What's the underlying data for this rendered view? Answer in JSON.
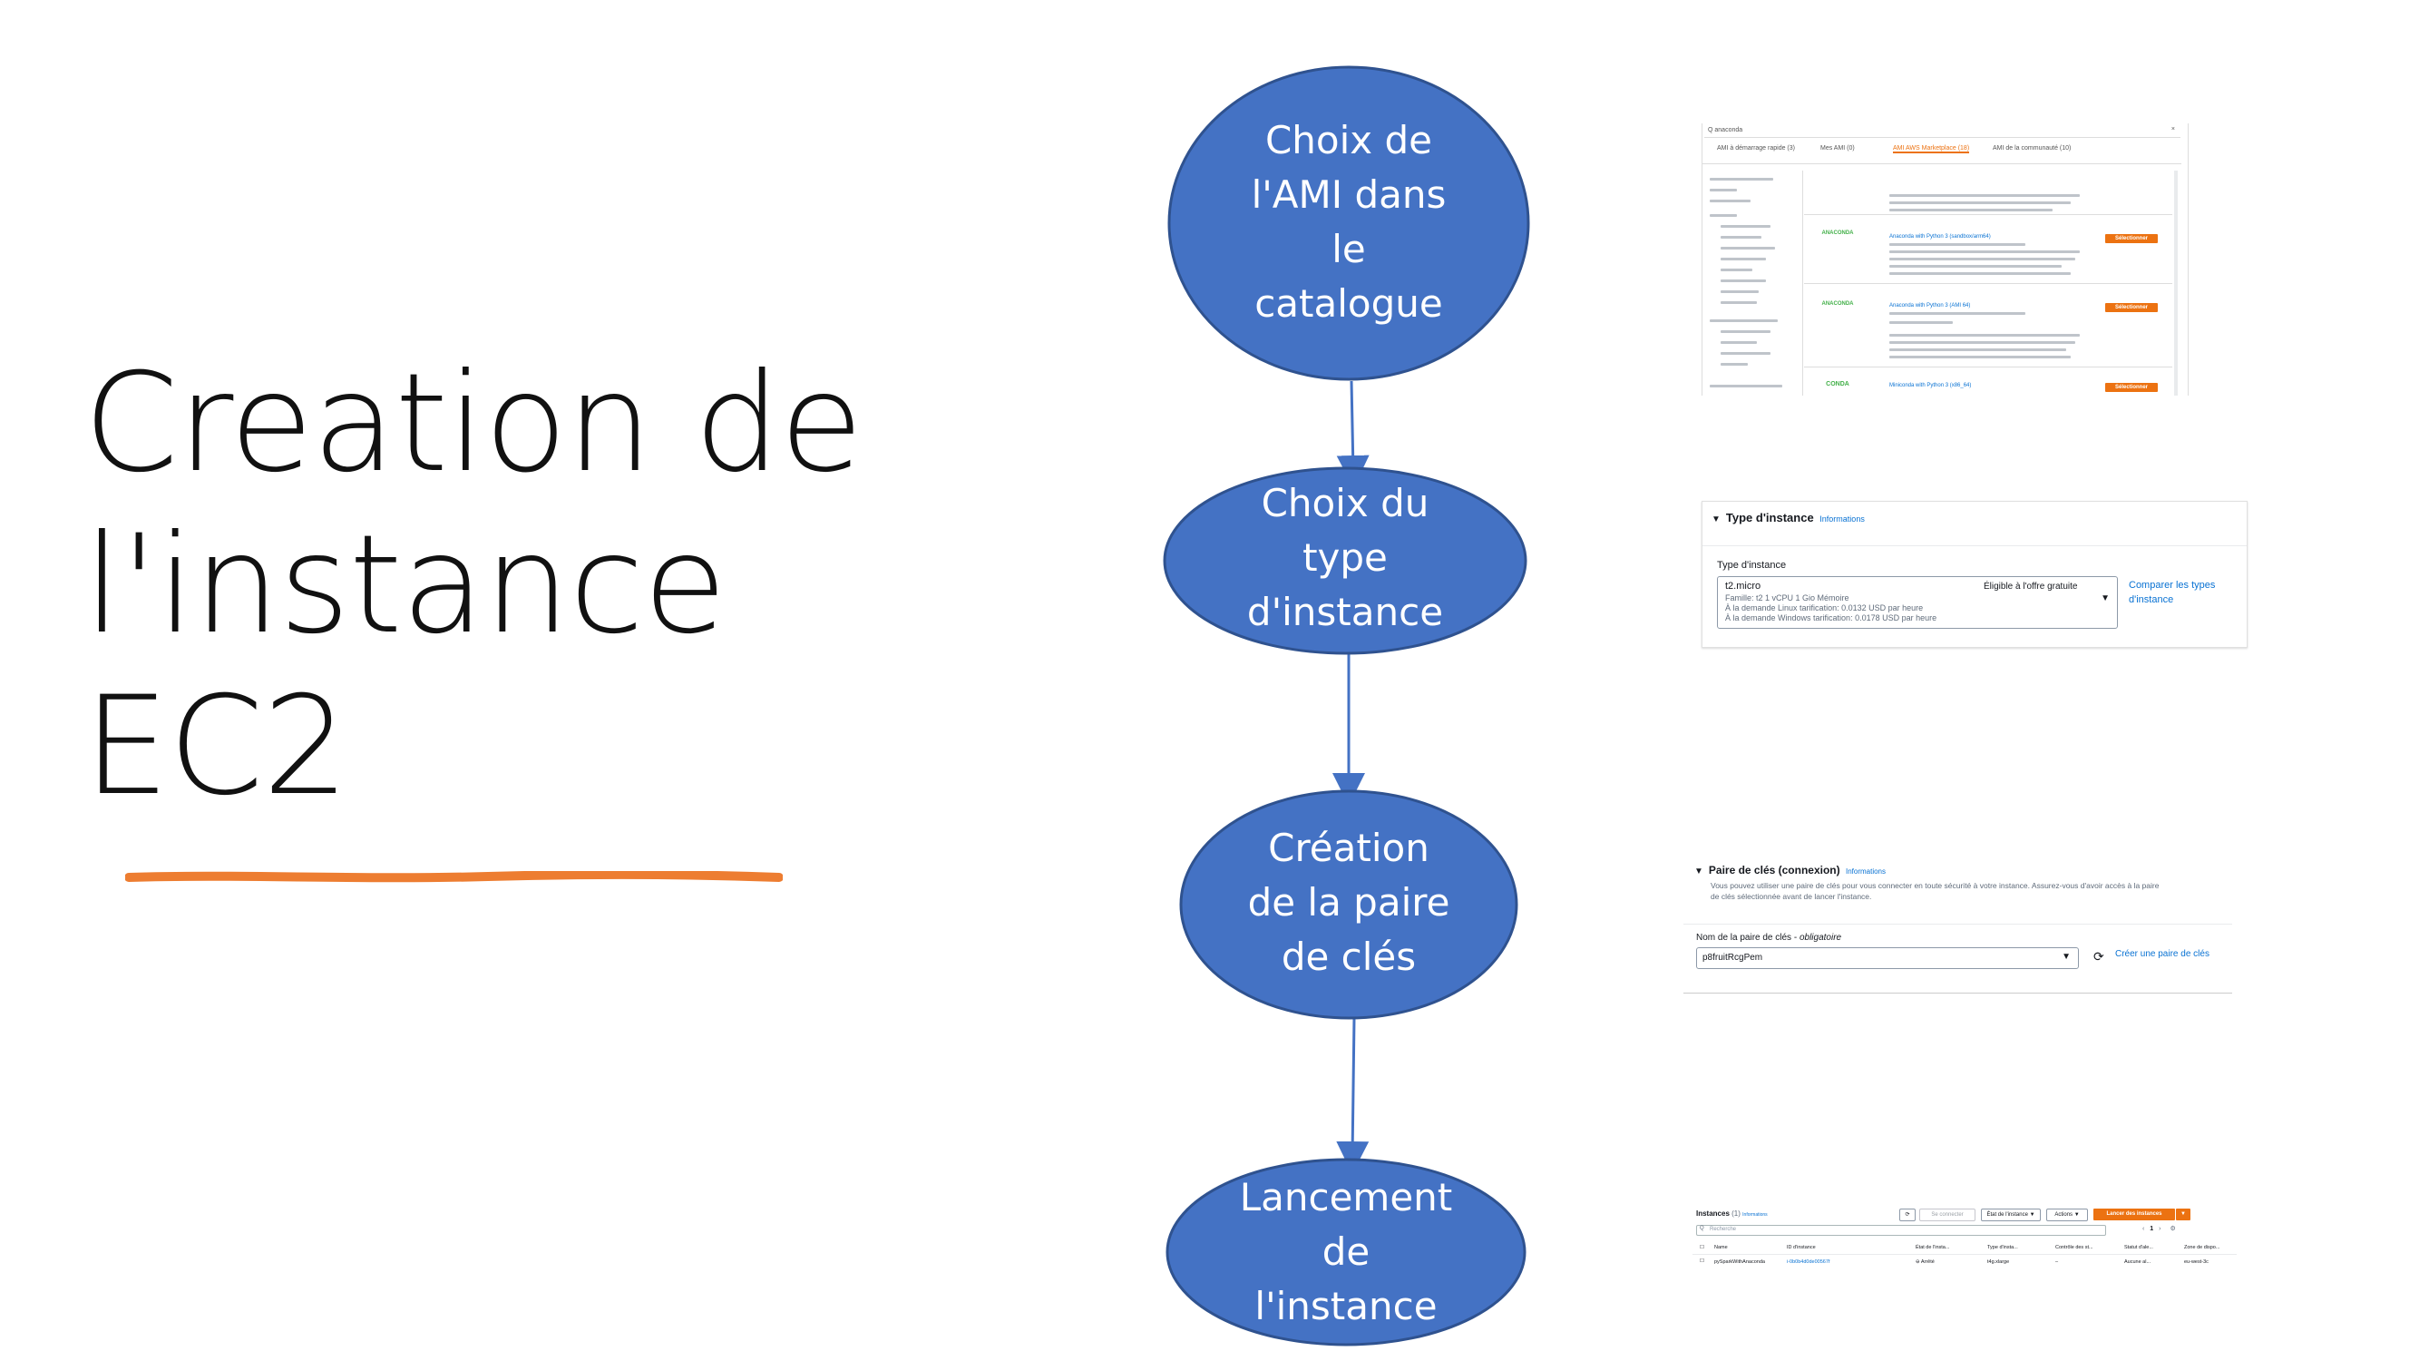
{
  "title": {
    "line1": "Creation de",
    "line2": "l'instance",
    "line3": "EC2"
  },
  "colors": {
    "node": "#4472c4",
    "node_border": "#2f528f",
    "arrow": "#4472c4",
    "underline": "#ed7d31"
  },
  "steps": [
    {
      "label": "Choix de l'AMI dans le catalogue",
      "lines": [
        "Choix de",
        "l'AMI dans",
        "le",
        "catalogue"
      ]
    },
    {
      "label": "Choix du type d'instance",
      "lines": [
        "Choix du",
        "type",
        "d'instance"
      ]
    },
    {
      "label": "Création de la paire de clés",
      "lines": [
        "Création",
        "de la paire",
        "de clés"
      ]
    },
    {
      "label": "Lancement de l'instance",
      "lines": [
        "Lancement",
        "de",
        "l'instance"
      ]
    }
  ],
  "ami_panel": {
    "search": "Q anaconda",
    "tabs": [
      "AMI à démarrage rapide (3)",
      "Mes AMI (0)",
      "AMI AWS Marketplace (18)",
      "AMI de la communauté (10)"
    ],
    "items": [
      {
        "logo": "ANACONDA",
        "name": "Anaconda with Python 3 (sandbox/arm64)",
        "button": "Sélectionner"
      },
      {
        "logo": "ANACONDA",
        "name": "Anaconda with Python 3 (AMI 64)",
        "button": "Sélectionner"
      },
      {
        "logo": "CONDA",
        "name": "Miniconda with Python 3 (x86_64)",
        "button": "Sélectionner"
      }
    ]
  },
  "instance_type_panel": {
    "header": "Type d'instance",
    "info": "Informations",
    "field_label": "Type d'instance",
    "selected": "t2.micro",
    "free_tier": "Éligible à l'offre gratuite",
    "detail1": "Famille: t2    1 vCPU    1 Gio Mémoire",
    "detail2": "À la demande Linux tarification: 0.0132 USD par heure",
    "detail3": "À la demande Windows tarification: 0.0178 USD par heure",
    "compare_link": "Comparer les types d'instance"
  },
  "keypair_panel": {
    "header": "Paire de clés (connexion)",
    "info": "Informations",
    "desc1": "Vous pouvez utiliser une paire de clés pour vous connecter en toute sécurité à votre instance. Assurez-vous d'avoir accès à la paire",
    "desc2": "de clés sélectionnée avant de lancer l'instance.",
    "field_label": "Nom de la paire de clés -",
    "required": "obligatoire",
    "selected": "p8fruitRcgPem",
    "create_link": "Créer une paire de clés"
  },
  "instances_panel": {
    "header": "Instances",
    "count": "(1)",
    "info": "Informations",
    "search_placeholder": "Recherche",
    "buttons": [
      "Se connecter",
      "État de l'instance ▼",
      "Actions ▼",
      "Lancer des instances"
    ],
    "columns": [
      "Name",
      "ID d'instance",
      "État de l'insta...",
      "Type d'insta...",
      "Contrôle des st...",
      "Statut d'ale...",
      "Zone de dispo..."
    ],
    "row": [
      "pySparkWithAnaconda",
      "i-0b0b4d0de00567f",
      "Arrêté",
      "t4g.xlarge",
      "–",
      "Aucune al...",
      "eu-west-3c"
    ],
    "page": "1"
  }
}
